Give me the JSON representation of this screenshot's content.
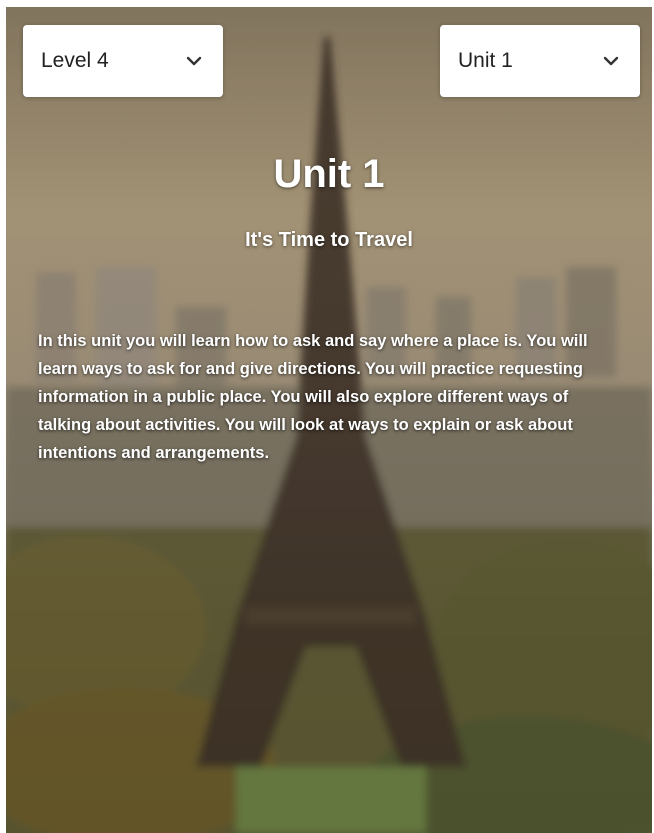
{
  "selectors": {
    "level": {
      "value": "Level 4"
    },
    "unit": {
      "value": "Unit 1"
    }
  },
  "header": {
    "title": "Unit 1",
    "subtitle": "It's Time to Travel"
  },
  "description": "In this unit you will learn how to ask and say where a place is. You will learn ways to ask for and give directions. You will practice requesting information in a public place. You will also explore different ways of talking about activities. You will look at ways to explain or ask about intentions and arrangements.",
  "icons": {
    "dropdown": "chevron-down-icon",
    "background": "eiffel-tower-photo"
  }
}
